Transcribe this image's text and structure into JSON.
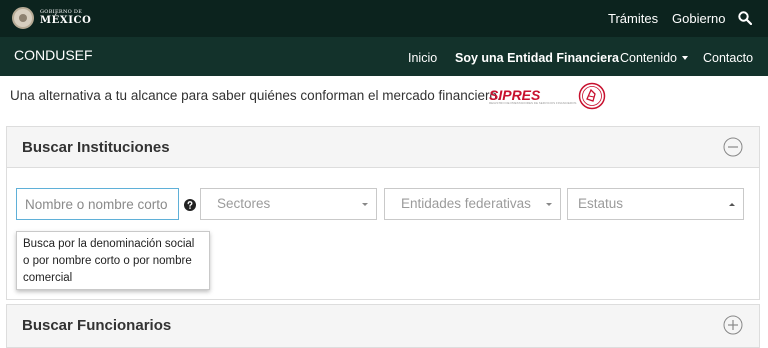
{
  "gov_bar": {
    "logo_line1": "GOBIERNO DE",
    "logo_line2": "MÉXICO",
    "links": [
      "Trámites",
      "Gobierno"
    ]
  },
  "nav": {
    "brand": "CONDUSEF",
    "items": [
      "Inicio",
      "Soy una Entidad Financiera",
      "Contenido",
      "Contacto"
    ]
  },
  "tagline": "Una alternativa a tu alcance para saber quiénes conforman el mercado financiero.",
  "sipres_logo": {
    "text": "SIPRES",
    "subtitle": "REGISTRO DE PRESTADORES DE SERVICIOS FINANCIEROS"
  },
  "panels": {
    "instituciones": {
      "title": "Buscar Instituciones",
      "expanded": true,
      "search": {
        "placeholder": "Nombre o nombre corto",
        "value": ""
      },
      "filters": {
        "sectores": "Sectores",
        "entidades": "Entidades federativas",
        "estatus": "Estatus"
      },
      "tooltip": "Busca por la denominación social o por nombre corto o por nombre comercial"
    },
    "funcionarios": {
      "title": "Buscar Funcionarios",
      "expanded": false
    }
  },
  "icons": {
    "search": "search-icon",
    "collapse": "minus-circle-icon",
    "expand": "plus-circle-icon",
    "help": "question-circle-icon"
  },
  "colors": {
    "gov_bar": "#0c231e",
    "nav_bar": "#13322b",
    "focus_border": "#5fb0d8",
    "sipres_red": "#c8102e"
  }
}
